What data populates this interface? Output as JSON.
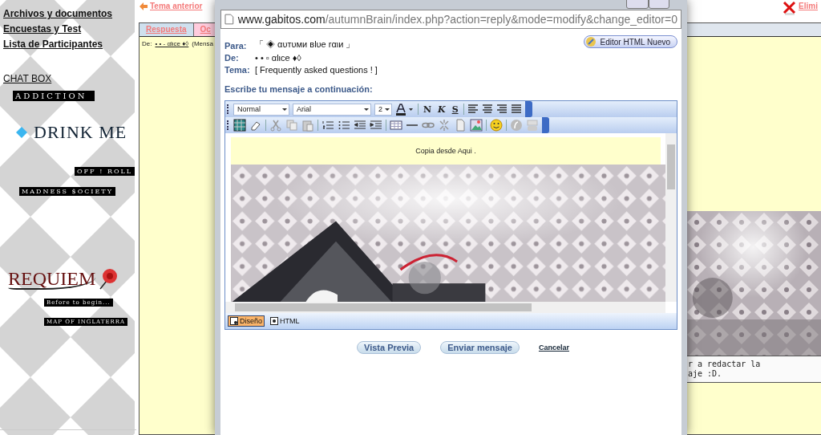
{
  "sidebar": {
    "links": [
      "Archivos y documentos",
      "Encuestas y Test",
      "Lista de Participantes"
    ],
    "chat_link": "CHAT BOX",
    "banners": [
      {
        "kind": "black",
        "label": "ADDICTION"
      },
      {
        "kind": "diamond",
        "label": "DRINK ME"
      },
      {
        "kind": "black",
        "label": "OFF ! ROLL"
      },
      {
        "kind": "black",
        "label": "MADNESS $OCIETY"
      },
      {
        "kind": "logo",
        "label": "REQUIEM"
      },
      {
        "kind": "black",
        "label": "Before to begin..."
      },
      {
        "kind": "black",
        "label": "MAP OF INGLATERRA"
      }
    ]
  },
  "page": {
    "prev_topic": "Tema anterior",
    "delete": "Elimi",
    "tabs": [
      {
        "label": "Respuesta",
        "selected": true
      },
      {
        "label": "Oc",
        "selected": false
      }
    ],
    "post_from_label": "De:",
    "post_author": "• • - αlιce ♦◊",
    "post_note": "(Mensa",
    "side_text": [
      "r a redactar la",
      "aje :D."
    ]
  },
  "popup": {
    "url_domain": "www.gabitos.com",
    "url_path": "/autumnBrain/index.php?action=reply&mode=modify&change_editor=0",
    "editor_button": "Editor HTML Nuevo",
    "fields": [
      {
        "label": "Para:",
        "value": "「 ◈ αυтυми вlυe rαιи 」"
      },
      {
        "label": "De:",
        "value": "• • ▫ αlιce ♦◊"
      },
      {
        "label": "Tema:",
        "value": "[ Frequently asked questions ! ]"
      }
    ],
    "prompt": "Escribe tu mensaje a continuación:",
    "toolbar": {
      "style": "Normal",
      "font": "Arial",
      "size": "2",
      "bold": "N",
      "italic": "K",
      "strike": "S"
    },
    "content_text": "Copia desde Aqui .",
    "modes": [
      {
        "label": "Diseño",
        "selected": true
      },
      {
        "label": "HTML",
        "selected": false
      }
    ],
    "buttons": [
      "Vista Previa",
      "Enviar mensaje"
    ],
    "cancel": "Cancelar"
  }
}
